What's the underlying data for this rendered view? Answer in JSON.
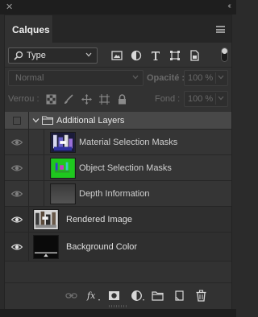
{
  "window": {
    "close_glyph": "✕",
    "collapse_glyph": "‹‹"
  },
  "panel": {
    "tab_label": "Calques",
    "menu_icon": "panel-menu-icon"
  },
  "filter": {
    "kind_label": "Type",
    "icons": [
      "image-filter-icon",
      "adjustment-filter-icon",
      "type-filter-icon",
      "shape-filter-icon",
      "smart-object-filter-icon"
    ],
    "toggle_on": true
  },
  "blend": {
    "mode": "Normal",
    "opacity_label": "Opacité :",
    "opacity_value": "100 %"
  },
  "lock": {
    "label": "Verrou :",
    "fill_label": "Fond :",
    "fill_value": "100 %"
  },
  "layers": [
    {
      "type": "group",
      "name": "Additional Layers",
      "expanded": true
    },
    {
      "type": "sub",
      "name": "Material Selection Masks",
      "visible": false
    },
    {
      "type": "sub",
      "name": "Object Selection Masks",
      "visible": false
    },
    {
      "type": "sub",
      "name": "Depth Information",
      "visible": false
    },
    {
      "type": "layer",
      "name": "Rendered Image",
      "visible": true
    },
    {
      "type": "layer",
      "name": "Background Color",
      "visible": true
    }
  ],
  "bottom_icons": [
    "link-icon",
    "fx-icon",
    "mask-icon",
    "adjustment-icon",
    "folder-icon",
    "new-layer-icon",
    "trash-icon"
  ],
  "colors": {
    "panel_bg": "#323232",
    "group_bg": "#484848",
    "green_mask": "#1ec81e"
  }
}
